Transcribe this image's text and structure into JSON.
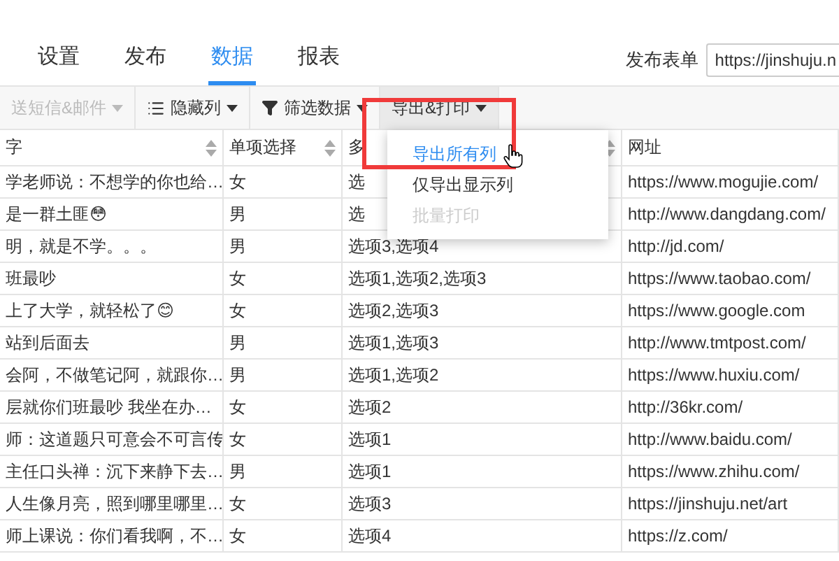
{
  "tabs": [
    {
      "label": "设置",
      "selected": false
    },
    {
      "label": "发布",
      "selected": false
    },
    {
      "label": "数据",
      "selected": true
    },
    {
      "label": "报表",
      "selected": false
    }
  ],
  "publish": {
    "label": "发布表单",
    "value": "https://jinshuju.n"
  },
  "toolbar": [
    {
      "label": "送短信&邮件",
      "disabled": true,
      "open": false
    },
    {
      "label": "隐藏列",
      "disabled": false,
      "open": false
    },
    {
      "label": "筛选数据",
      "disabled": false,
      "open": false
    },
    {
      "label": "导出&打印",
      "disabled": false,
      "open": true
    }
  ],
  "export_menu": [
    {
      "label": "导出所有列",
      "selected": true,
      "disabled": false
    },
    {
      "label": "仅导出显示列",
      "selected": false,
      "disabled": false
    },
    {
      "label": "批量打印",
      "selected": false,
      "disabled": true
    }
  ],
  "table": {
    "columns": [
      {
        "label": "字",
        "sortable": true
      },
      {
        "label": "单项选择",
        "sortable": true
      },
      {
        "label": "多",
        "sortable": true
      },
      {
        "label": "网址",
        "sortable": false
      }
    ],
    "rows": [
      [
        "学老师说：不想学的你也给…",
        "女",
        "选",
        "https://www.mogujie.com/"
      ],
      [
        "是一群土匪😳",
        "男",
        "选",
        "http://www.dangdang.com/"
      ],
      [
        "明，就是不学。。。",
        "男",
        "选项3,选项4",
        "http://jd.com/"
      ],
      [
        "班最吵",
        "女",
        "选项1,选项2,选项3",
        "https://www.taobao.com/"
      ],
      [
        "上了大学，就轻松了😊",
        "女",
        "选项2,选项3",
        "https://www.google.com"
      ],
      [
        "站到后面去",
        "男",
        "选项1,选项3",
        "http://www.tmtpost.com/"
      ],
      [
        "会阿，不做笔记阿，就跟你…",
        "男",
        "选项1,选项2",
        "https://www.huxiu.com/"
      ],
      [
        "层就你们班最吵 我坐在办…",
        "女",
        "选项2",
        "http://36kr.com/"
      ],
      [
        "师：这道题只可意会不可言传",
        "女",
        "选项1",
        "http://www.baidu.com/"
      ],
      [
        "主任口头禅：沉下来静下去…",
        "男",
        "选项1",
        "https://www.zhihu.com/"
      ],
      [
        "人生像月亮，照到哪里哪里…",
        "女",
        "选项3",
        "https://jinshuju.net/art"
      ],
      [
        "师上课说：你们看我啊，不…",
        "女",
        "选项4",
        "https://z.com/"
      ]
    ]
  }
}
